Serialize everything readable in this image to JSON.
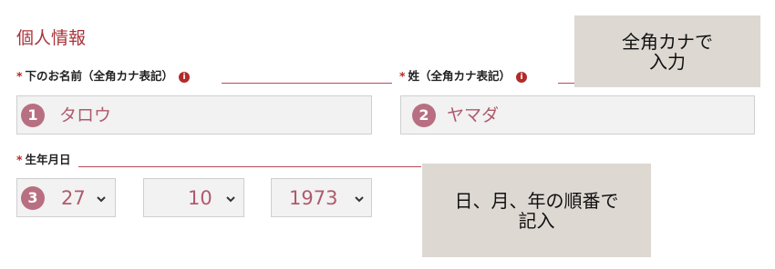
{
  "section": {
    "title": "個人情報"
  },
  "first_name": {
    "label": "下のお名前（全角カナ表記）",
    "required_mark": "*",
    "info_icon": "i",
    "step": "1",
    "value": "タロウ"
  },
  "last_name": {
    "label": "姓（全角カナ表記）",
    "required_mark": "*",
    "info_icon": "i",
    "step": "2",
    "value": "ヤマダ"
  },
  "birthday": {
    "label": "生年月日",
    "required_mark": "*",
    "step": "3",
    "day": "27",
    "month": "10",
    "year": "1973"
  },
  "notes": {
    "kana_line1": "全角カナで",
    "kana_line2": "入力",
    "date_line1": "日、月、年の順番で",
    "date_line2": "記入"
  },
  "colors": {
    "accent": "#a8333a",
    "badge": "#b86f82",
    "value_text": "#b05a6d",
    "field_bg": "#f2f2f2",
    "note_bg": "#ddd8d2"
  }
}
